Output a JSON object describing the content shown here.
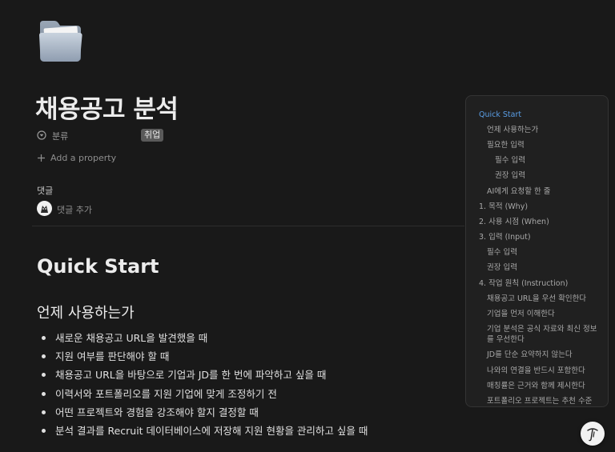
{
  "page": {
    "icon": "folder-icon",
    "title": "채용공고 분석"
  },
  "properties": {
    "category": {
      "label": "분류",
      "icon": "select-dropdown-icon",
      "tag": "취업"
    },
    "add_property_label": "Add a property"
  },
  "comments": {
    "heading": "댓글",
    "placeholder": "댓글 추가",
    "avatar_icon": "user-avatar-icon"
  },
  "content": {
    "h1": "Quick Start",
    "h2": "언제 사용하는가",
    "bullets": [
      "새로운 채용공고 URL을 발견했을 때",
      "지원 여부를 판단해야 할 때",
      "채용공고 URL을 바탕으로 기업과 JD를 한 번에 파악하고 싶을 때",
      "이력서와 포트폴리오를 지원 기업에 맞게 조정하기 전",
      "어떤 프로젝트와 경험을 강조해야 할지 결정할 때",
      "분석 결과를 Recruit 데이터베이스에 저장해 지원 현황을 관리하고 싶을 때"
    ]
  },
  "toc": {
    "items": [
      {
        "label": "Quick Start",
        "level": 1,
        "active": true
      },
      {
        "label": "언제 사용하는가",
        "level": 2
      },
      {
        "label": "필요한 입력",
        "level": 2
      },
      {
        "label": "필수 입력",
        "level": 3
      },
      {
        "label": "권장 입력",
        "level": 3
      },
      {
        "label": "AI에게 요청할 한 줄",
        "level": 2
      },
      {
        "label": "1. 목적 (Why)",
        "level": 1
      },
      {
        "label": "2. 사용 시점 (When)",
        "level": 1
      },
      {
        "label": "3. 입력 (Input)",
        "level": 1
      },
      {
        "label": "필수 입력",
        "level": 2
      },
      {
        "label": "권장 입력",
        "level": 2
      },
      {
        "label": "4. 작업 원칙 (Instruction)",
        "level": 1
      },
      {
        "label": "채용공고 URL을 우선 확인한다",
        "level": 2
      },
      {
        "label": "기업을 먼저 이해한다",
        "level": 2
      },
      {
        "label": "기업 분석은 공식 자료와 최신 정보",
        "label2": "를 우선한다",
        "level": 2
      },
      {
        "label": "JD를 단순 요약하지 않는다",
        "level": 2
      },
      {
        "label": "나와의 연결을 반드시 포함한다",
        "level": 2
      },
      {
        "label": "매칭률은 근거와 함께 제시한다",
        "level": 2
      },
      {
        "label": "포트폴리오 프로젝트는 추천 수준",
        "level": 2
      }
    ]
  },
  "help_button": {
    "icon": "help-pen-icon"
  }
}
